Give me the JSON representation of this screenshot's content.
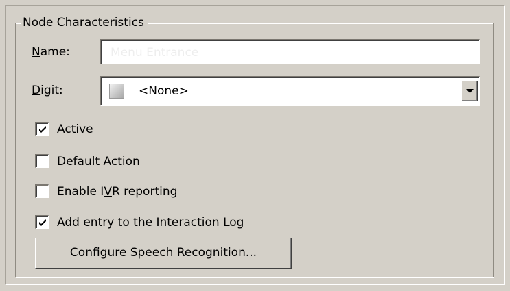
{
  "group": {
    "title": "Node Characteristics"
  },
  "name_field": {
    "label_pre": "",
    "label_accel": "N",
    "label_post": "ame:",
    "value": "Menu Entrance"
  },
  "digit_field": {
    "label_pre": "",
    "label_accel": "D",
    "label_post": "igit:",
    "selected": "<None>"
  },
  "checkboxes": [
    {
      "label_pre": "Ac",
      "label_accel": "t",
      "label_post": "ive",
      "checked": true
    },
    {
      "label_pre": "Default ",
      "label_accel": "A",
      "label_post": "ction",
      "checked": false
    },
    {
      "label_pre": "Enable I",
      "label_accel": "V",
      "label_post": "R reporting",
      "checked": false
    },
    {
      "label_pre": "Add entr",
      "label_accel": "y",
      "label_post": " to the Interaction Log",
      "checked": true
    }
  ],
  "configure_button": {
    "label": "Configure Speech Recognition..."
  }
}
